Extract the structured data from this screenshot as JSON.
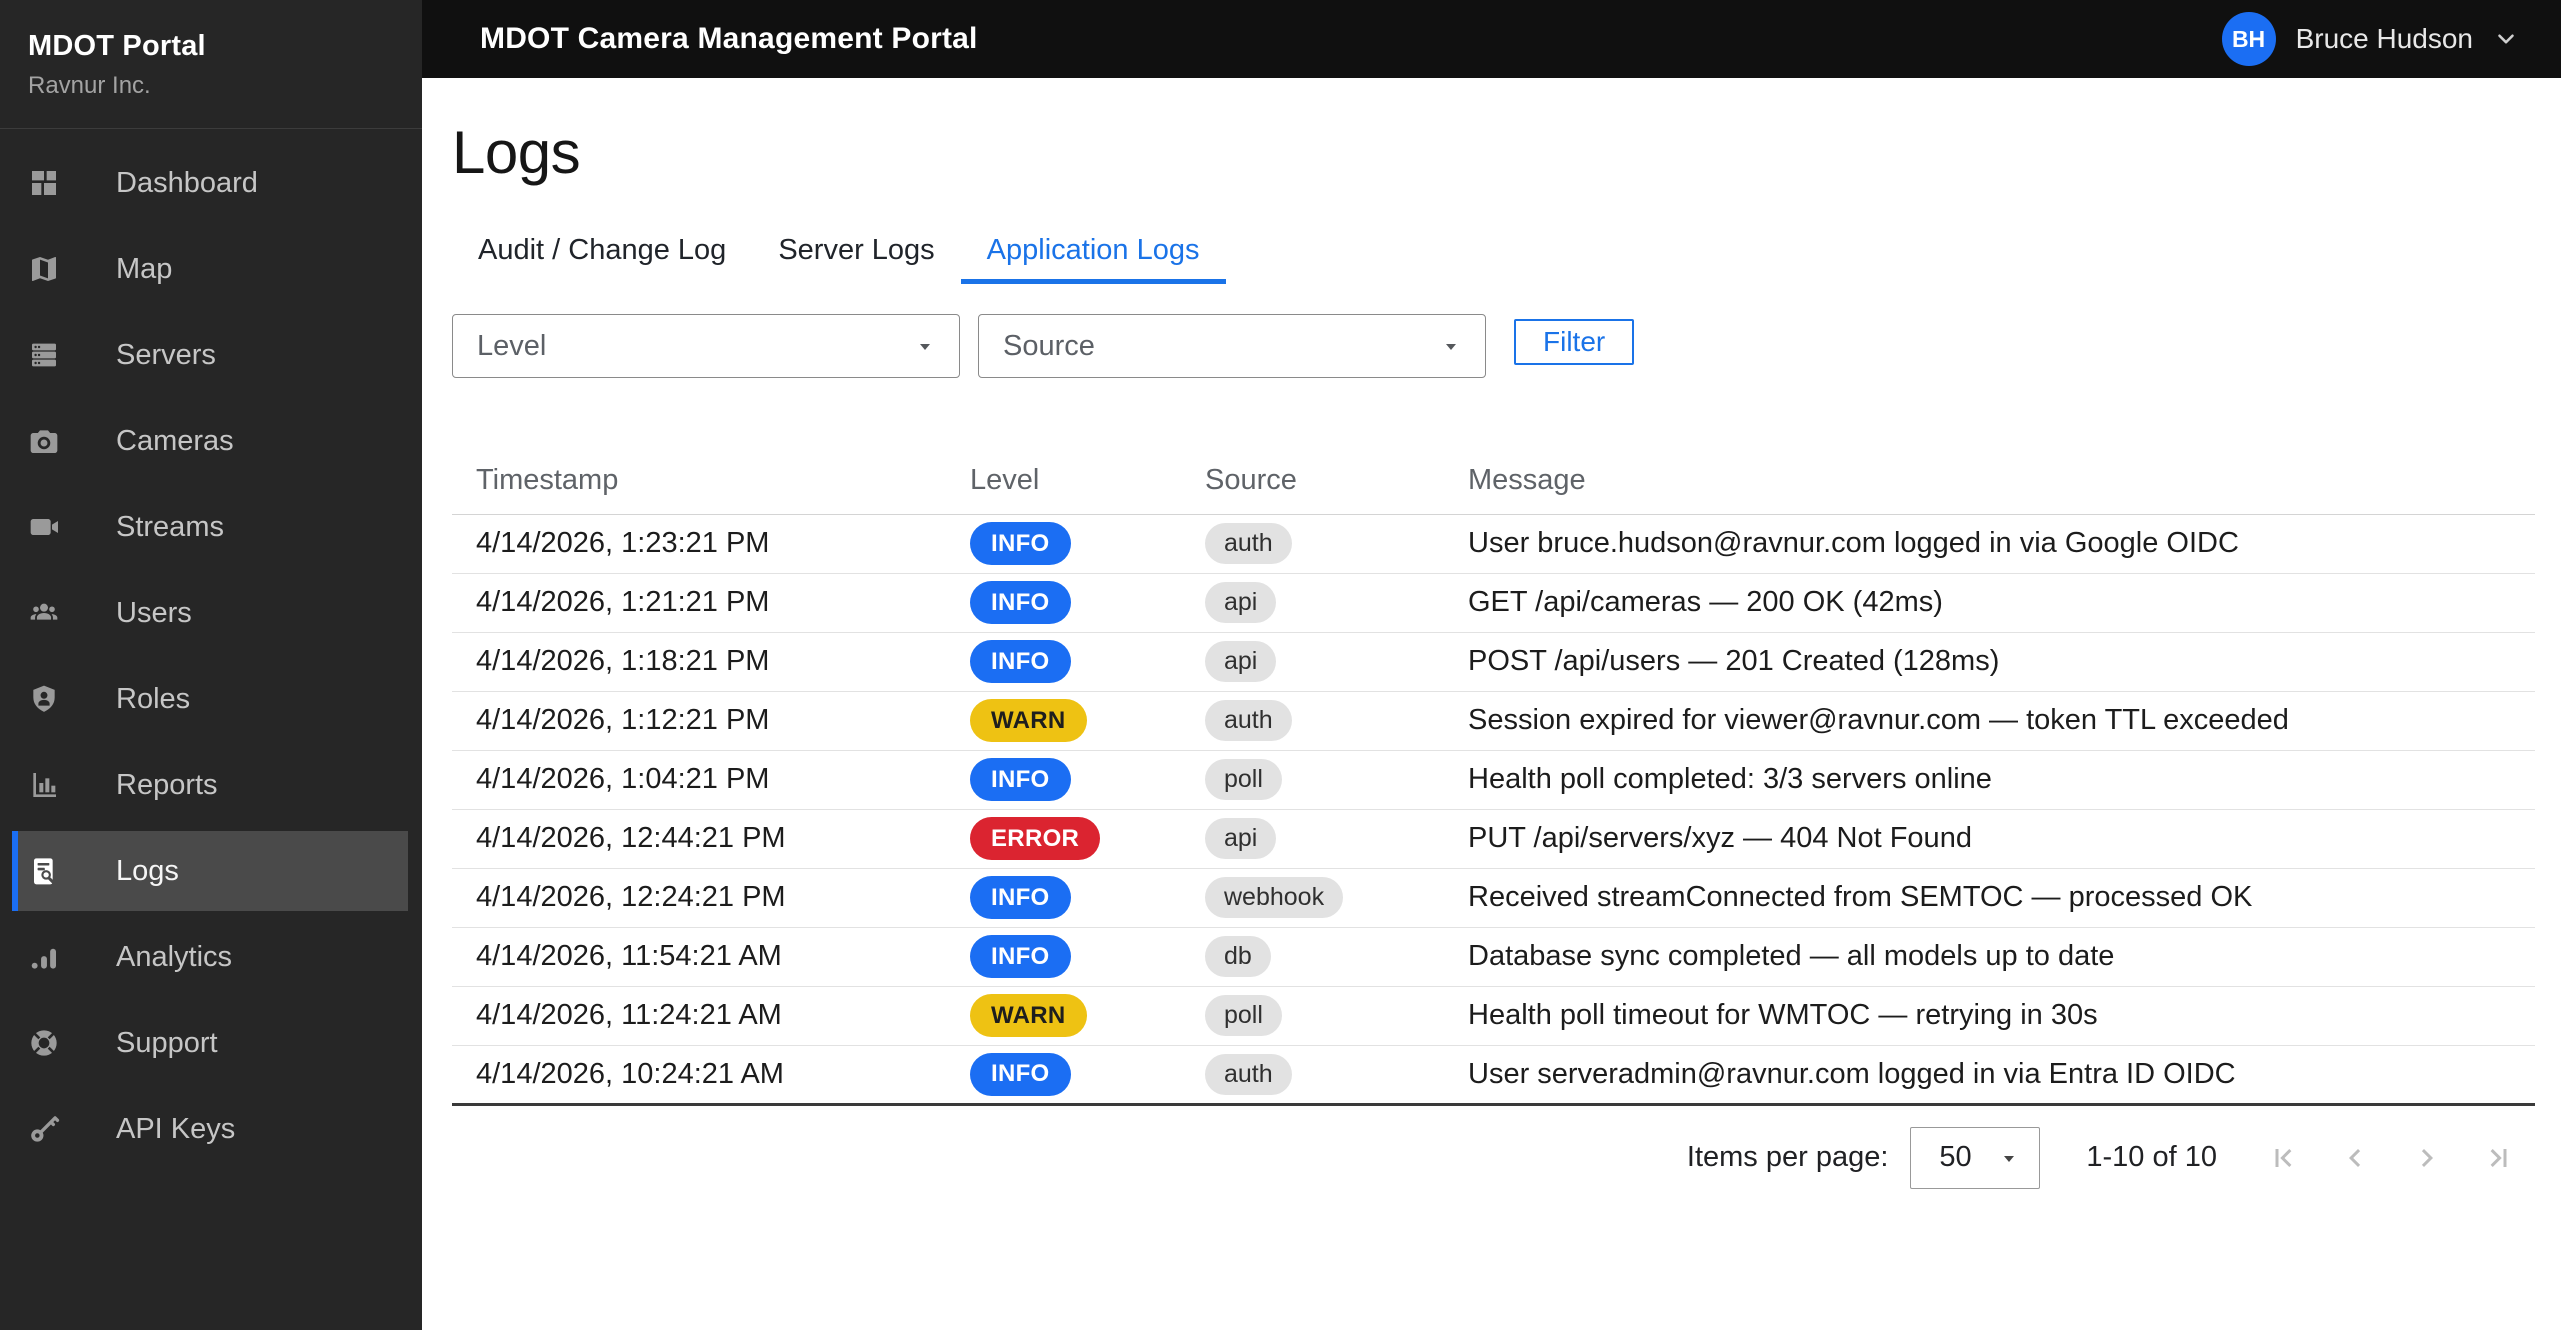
{
  "colors": {
    "accent": "#1a73e8",
    "info": "#1b6ef3",
    "warn": "#eec213",
    "warn_text": "#1e1e1e",
    "error": "#db2430",
    "source_chip_bg": "#e2e2e2"
  },
  "sidebar": {
    "brand": {
      "title": "MDOT Portal",
      "subtitle": "Ravnur Inc."
    },
    "items": [
      {
        "label": "Dashboard",
        "icon": "dashboard-icon",
        "active": false
      },
      {
        "label": "Map",
        "icon": "map-icon",
        "active": false
      },
      {
        "label": "Servers",
        "icon": "servers-icon",
        "active": false
      },
      {
        "label": "Cameras",
        "icon": "camera-icon",
        "active": false
      },
      {
        "label": "Streams",
        "icon": "video-camera-icon",
        "active": false
      },
      {
        "label": "Users",
        "icon": "users-icon",
        "active": false
      },
      {
        "label": "Roles",
        "icon": "shield-user-icon",
        "active": false
      },
      {
        "label": "Reports",
        "icon": "bar-chart-icon",
        "active": false
      },
      {
        "label": "Logs",
        "icon": "document-search-icon",
        "active": true
      },
      {
        "label": "Analytics",
        "icon": "analytics-icon",
        "active": false
      },
      {
        "label": "Support",
        "icon": "lifebuoy-icon",
        "active": false
      },
      {
        "label": "API Keys",
        "icon": "key-icon",
        "active": false
      }
    ]
  },
  "topbar": {
    "title": "MDOT Camera Management Portal",
    "user": {
      "initials": "BH",
      "name": "Bruce Hudson"
    }
  },
  "page": {
    "title": "Logs"
  },
  "tabs": [
    {
      "label": "Audit / Change Log",
      "active": false
    },
    {
      "label": "Server Logs",
      "active": false
    },
    {
      "label": "Application Logs",
      "active": true
    }
  ],
  "filters": {
    "level_placeholder": "Level",
    "source_placeholder": "Source",
    "filter_button_label": "Filter"
  },
  "table": {
    "headers": [
      "Timestamp",
      "Level",
      "Source",
      "Message"
    ],
    "rows": [
      {
        "timestamp": "4/14/2026, 1:23:21 PM",
        "level": "INFO",
        "source": "auth",
        "message": "User bruce.hudson@ravnur.com logged in via Google OIDC"
      },
      {
        "timestamp": "4/14/2026, 1:21:21 PM",
        "level": "INFO",
        "source": "api",
        "message": "GET /api/cameras — 200 OK (42ms)"
      },
      {
        "timestamp": "4/14/2026, 1:18:21 PM",
        "level": "INFO",
        "source": "api",
        "message": "POST /api/users — 201 Created (128ms)"
      },
      {
        "timestamp": "4/14/2026, 1:12:21 PM",
        "level": "WARN",
        "source": "auth",
        "message": "Session expired for viewer@ravnur.com — token TTL exceeded"
      },
      {
        "timestamp": "4/14/2026, 1:04:21 PM",
        "level": "INFO",
        "source": "poll",
        "message": "Health poll completed: 3/3 servers online"
      },
      {
        "timestamp": "4/14/2026, 12:44:21 PM",
        "level": "ERROR",
        "source": "api",
        "message": "PUT /api/servers/xyz — 404 Not Found"
      },
      {
        "timestamp": "4/14/2026, 12:24:21 PM",
        "level": "INFO",
        "source": "webhook",
        "message": "Received streamConnected from SEMTOC — processed OK"
      },
      {
        "timestamp": "4/14/2026, 11:54:21 AM",
        "level": "INFO",
        "source": "db",
        "message": "Database sync completed — all models up to date"
      },
      {
        "timestamp": "4/14/2026, 11:24:21 AM",
        "level": "WARN",
        "source": "poll",
        "message": "Health poll timeout for WMTOC — retrying in 30s"
      },
      {
        "timestamp": "4/14/2026, 10:24:21 AM",
        "level": "INFO",
        "source": "auth",
        "message": "User serveradmin@ravnur.com logged in via Entra ID OIDC"
      }
    ]
  },
  "pagination": {
    "items_per_page_label": "Items per page:",
    "page_size": "50",
    "range_label": "1-10 of 10"
  }
}
